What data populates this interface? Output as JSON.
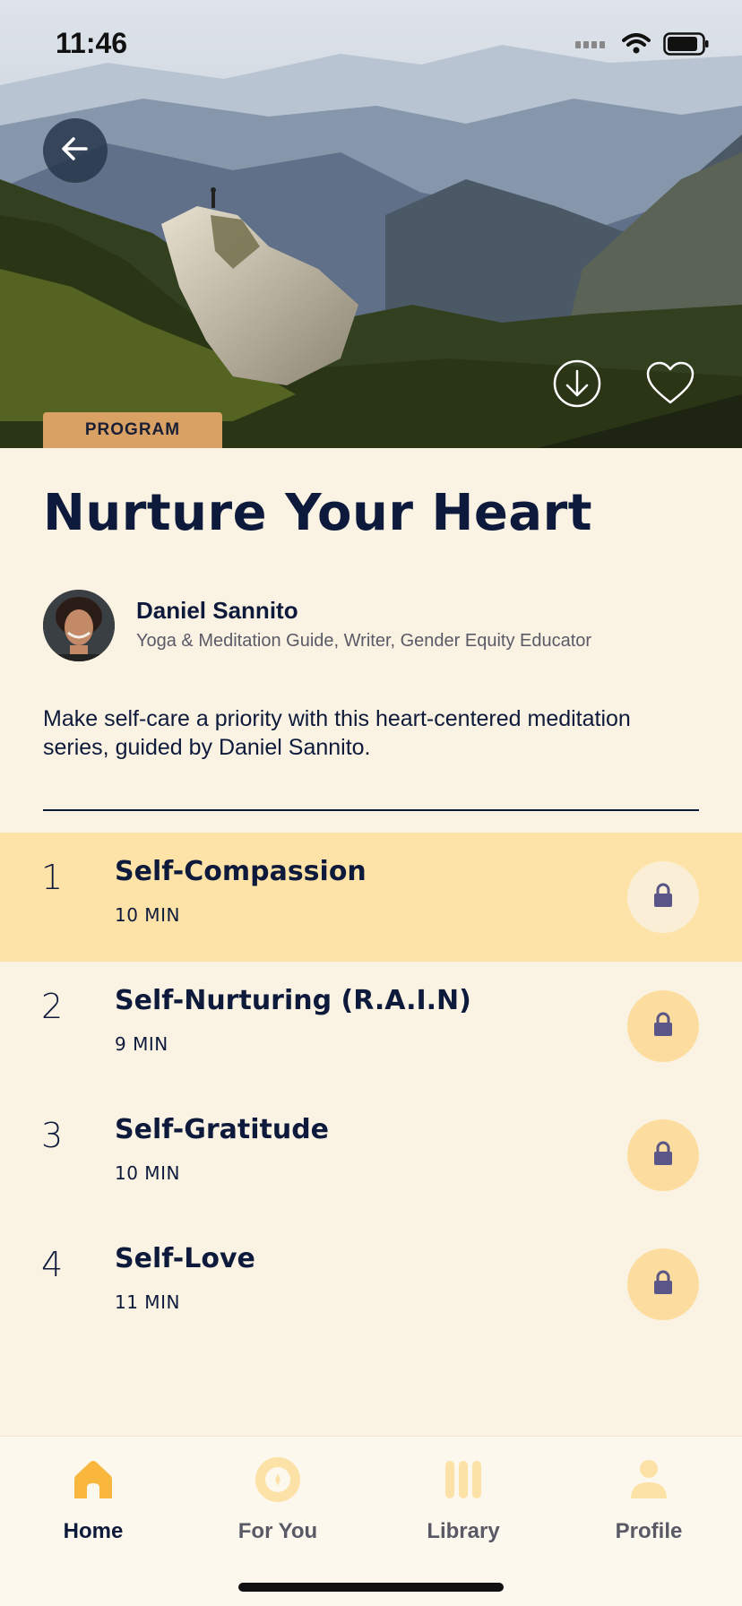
{
  "status_bar": {
    "time": "11:46"
  },
  "hero": {
    "tag": "PROGRAM",
    "icons": {
      "back": "arrow-left-icon",
      "download": "download-icon",
      "favorite": "heart-icon"
    }
  },
  "program": {
    "title": "Nurture Your Heart",
    "author": {
      "name": "Daniel Sannito",
      "role": "Yoga & Meditation Guide, Writer, Gender Equity Educator"
    },
    "description": "Make self-care a priority with this heart-centered meditation series, guided by Daniel Sannito."
  },
  "sessions": [
    {
      "number": "1",
      "title": "Self-Compassion",
      "duration": "10 MIN",
      "locked": true,
      "active": true
    },
    {
      "number": "2",
      "title": "Self-Nurturing (R.A.I.N)",
      "duration": "9 MIN",
      "locked": true,
      "active": false
    },
    {
      "number": "3",
      "title": "Self-Gratitude",
      "duration": "10 MIN",
      "locked": true,
      "active": false
    },
    {
      "number": "4",
      "title": "Self-Love",
      "duration": "11 MIN",
      "locked": true,
      "active": false
    }
  ],
  "tabs": [
    {
      "label": "Home",
      "icon": "home-icon",
      "active": true
    },
    {
      "label": "For You",
      "icon": "compass-icon",
      "active": false
    },
    {
      "label": "Library",
      "icon": "library-icon",
      "active": false
    },
    {
      "label": "Profile",
      "icon": "profile-icon",
      "active": false
    }
  ],
  "colors": {
    "background": "#faf3e3",
    "accent": "#f9b73d",
    "active_row": "#fee3a8",
    "tag": "#d9a264",
    "text": "#0e1a3b",
    "lock": "#5a5788"
  }
}
